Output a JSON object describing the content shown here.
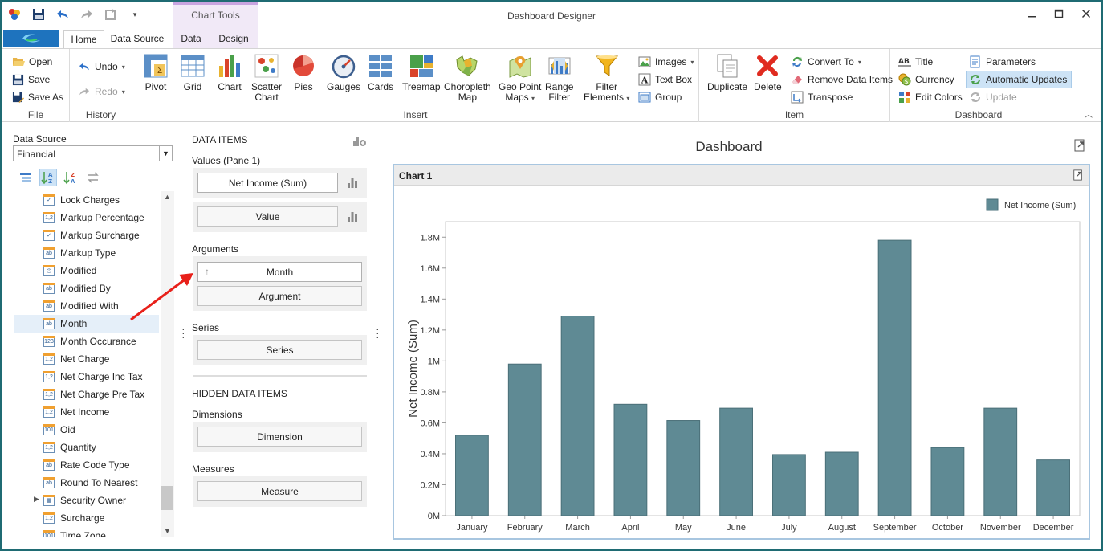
{
  "window": {
    "title": "Dashboard Designer",
    "context_tab_group": "Chart Tools"
  },
  "tabs": {
    "home": "Home",
    "data_source": "Data Source",
    "data": "Data",
    "design": "Design"
  },
  "ribbon": {
    "file": {
      "label": "File",
      "open": "Open",
      "save": "Save",
      "save_as": "Save As"
    },
    "history": {
      "label": "History",
      "undo": "Undo",
      "redo": "Redo"
    },
    "insert": {
      "label": "Insert",
      "pivot": "Pivot",
      "grid": "Grid",
      "chart": "Chart",
      "scatter_1": "Scatter",
      "scatter_2": "Chart",
      "pies": "Pies",
      "gauges": "Gauges",
      "cards": "Cards",
      "treemap": "Treemap",
      "choropleth_1": "Choropleth",
      "choropleth_2": "Map",
      "geo_1": "Geo Point",
      "geo_2": "Maps",
      "range_1": "Range",
      "range_2": "Filter",
      "filter_1": "Filter",
      "filter_2": "Elements",
      "images": "Images",
      "text_box": "Text Box",
      "group": "Group"
    },
    "item": {
      "label": "Item",
      "duplicate": "Duplicate",
      "delete": "Delete",
      "convert_to": "Convert To",
      "remove_data_items": "Remove Data Items",
      "transpose": "Transpose"
    },
    "dashboard": {
      "label": "Dashboard",
      "title": "Title",
      "currency": "Currency",
      "edit_colors": "Edit Colors",
      "parameters": "Parameters",
      "automatic_updates": "Automatic Updates",
      "update": "Update"
    }
  },
  "data_source": {
    "label": "Data Source",
    "selected": "Financial",
    "fields": [
      {
        "name": "Lock Charges",
        "type": "check"
      },
      {
        "name": "Markup Percentage",
        "type": "num"
      },
      {
        "name": "Markup Surcharge",
        "type": "check"
      },
      {
        "name": "Markup Type",
        "type": "ab"
      },
      {
        "name": "Modified",
        "type": "clock"
      },
      {
        "name": "Modified By",
        "type": "ab"
      },
      {
        "name": "Modified With",
        "type": "ab"
      },
      {
        "name": "Month",
        "type": "ab",
        "selected": true
      },
      {
        "name": "Month Occurance",
        "type": "int"
      },
      {
        "name": "Net Charge",
        "type": "num"
      },
      {
        "name": "Net Charge Inc Tax",
        "type": "num"
      },
      {
        "name": "Net Charge Pre Tax",
        "type": "num"
      },
      {
        "name": "Net Income",
        "type": "num"
      },
      {
        "name": "Oid",
        "type": "bin"
      },
      {
        "name": "Quantity",
        "type": "num"
      },
      {
        "name": "Rate Code Type",
        "type": "ab"
      },
      {
        "name": "Round To Nearest",
        "type": "ab"
      },
      {
        "name": "Security Owner",
        "type": "table",
        "expandable": true
      },
      {
        "name": "Surcharge",
        "type": "num"
      },
      {
        "name": "Time Zone",
        "type": "bin"
      }
    ]
  },
  "data_items": {
    "title": "DATA ITEMS",
    "values_label": "Values (Pane 1)",
    "value_item": "Net Income (Sum)",
    "value_placeholder": "Value",
    "arguments_label": "Arguments",
    "argument_item": "Month",
    "argument_placeholder": "Argument",
    "series_label": "Series",
    "series_placeholder": "Series",
    "hidden_title": "HIDDEN DATA ITEMS",
    "dimensions_label": "Dimensions",
    "dimension_placeholder": "Dimension",
    "measures_label": "Measures",
    "measure_placeholder": "Measure"
  },
  "dashboard": {
    "title": "Dashboard",
    "chart_item_title": "Chart 1"
  },
  "chart_data": {
    "type": "bar",
    "categories": [
      "January",
      "February",
      "March",
      "April",
      "May",
      "June",
      "July",
      "August",
      "September",
      "October",
      "November",
      "December"
    ],
    "series": [
      {
        "name": "Net Income (Sum)",
        "color": "#5f8a94",
        "values": [
          520000,
          980000,
          1290000,
          720000,
          615000,
          695000,
          395000,
          410000,
          1780000,
          440000,
          695000,
          360000
        ]
      }
    ],
    "ylabel": "Net Income (Sum)",
    "ylim": [
      0,
      1900000
    ],
    "y_ticks": [
      {
        "value": 0,
        "label": "0M"
      },
      {
        "value": 200000,
        "label": "0.2M"
      },
      {
        "value": 400000,
        "label": "0.4M"
      },
      {
        "value": 600000,
        "label": "0.6M"
      },
      {
        "value": 800000,
        "label": "0.8M"
      },
      {
        "value": 1000000,
        "label": "1M"
      },
      {
        "value": 1200000,
        "label": "1.2M"
      },
      {
        "value": 1400000,
        "label": "1.4M"
      },
      {
        "value": 1600000,
        "label": "1.6M"
      },
      {
        "value": 1800000,
        "label": "1.8M"
      }
    ],
    "legend": "top-right",
    "grid": false
  },
  "colors": {
    "accent": "#1e73be",
    "bar": "#5f8a94",
    "arrow": "#e8201a",
    "frame": "#1f6b73"
  }
}
